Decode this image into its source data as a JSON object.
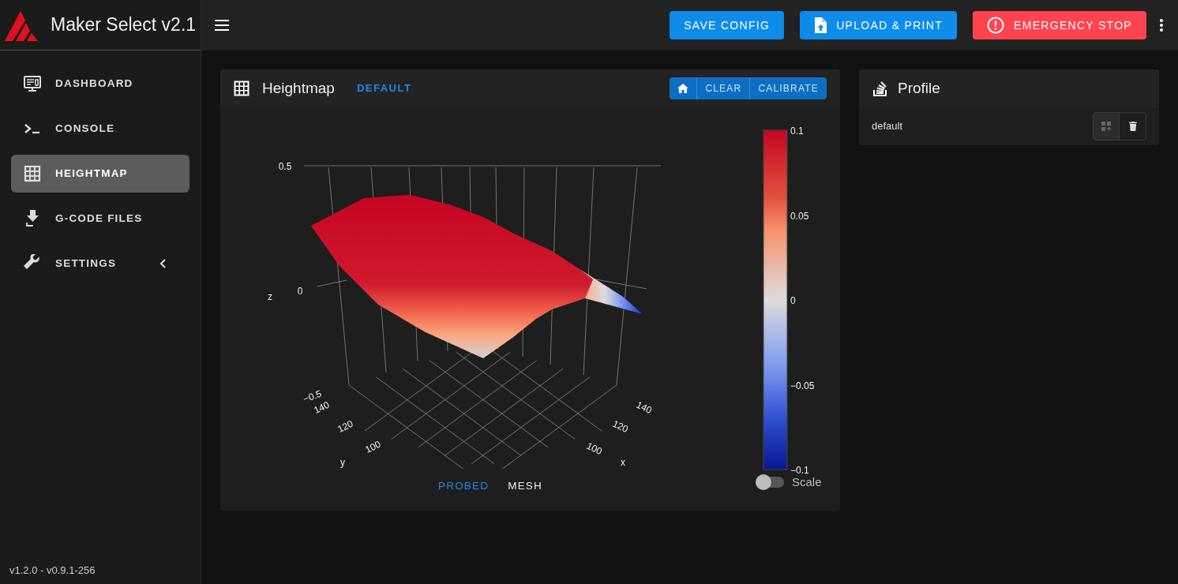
{
  "app_bar": {
    "title": "Maker Select v2.1",
    "buttons": [
      {
        "label": "SAVE CONFIG",
        "kind": "plain"
      },
      {
        "label": "UPLOAD & PRINT",
        "kind": "upload"
      },
      {
        "label": "EMERGENCY STOP",
        "kind": "stop"
      }
    ]
  },
  "sidebar": {
    "items": [
      {
        "label": "DASHBOARD",
        "selected": false,
        "expandable": false
      },
      {
        "label": "CONSOLE",
        "selected": false,
        "expandable": false
      },
      {
        "label": "HEIGHTMAP",
        "selected": true,
        "expandable": false
      },
      {
        "label": "G-CODE FILES",
        "selected": false,
        "expandable": false
      },
      {
        "label": "SETTINGS",
        "selected": false,
        "expandable": true
      }
    ],
    "version": "v1.2.0 - v0.9.1-256"
  },
  "heightmap": {
    "title": "Heightmap",
    "profile_name": "DEFAULT",
    "actions": [
      {
        "kind": "home"
      },
      {
        "kind": "text",
        "label": "CLEAR"
      },
      {
        "kind": "text",
        "label": "CALIBRATE"
      }
    ],
    "plot": {
      "z_title": "z",
      "z_ticks": [
        "0.5",
        "0",
        "−0.5"
      ],
      "y_title": "y",
      "y_ticks": [
        "140",
        "120",
        "100"
      ],
      "x_title": "x",
      "x_ticks": [
        "140",
        "120",
        "100"
      ],
      "colorbar_ticks": [
        "0.1",
        "0.05",
        "0",
        "−0.05",
        "−0.1"
      ]
    },
    "tabs": [
      {
        "label": "PROBED",
        "selected": true
      },
      {
        "label": "MESH",
        "selected": false
      }
    ],
    "scale_toggle": {
      "label": "Scale",
      "on": false
    }
  },
  "profile": {
    "title": "Profile",
    "rows": [
      {
        "name": "default"
      }
    ]
  }
}
